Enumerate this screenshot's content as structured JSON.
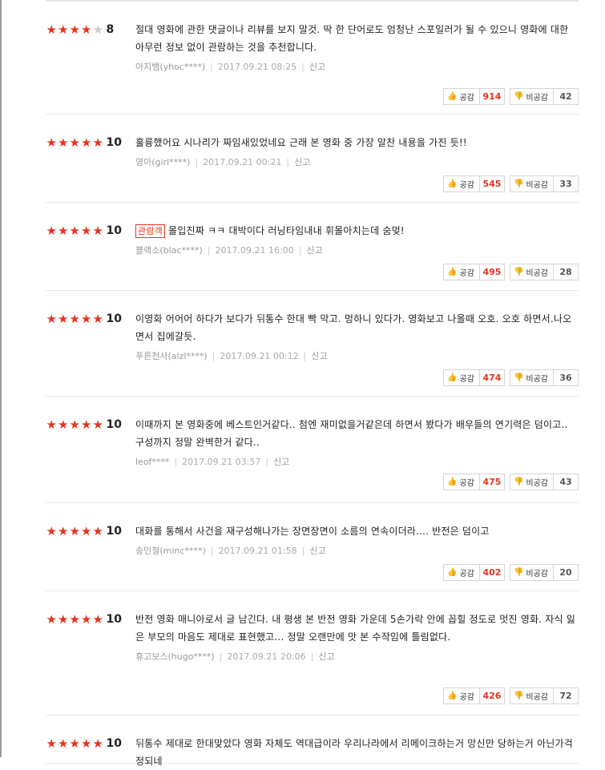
{
  "reviews": [
    {
      "score": "8",
      "stars": 4,
      "badge": "",
      "text": "절대 영화에 관한 댓글이나 리뷰를 보지 말것. 딱 한 단어로도 엄청난 스포일러가 될 수 있으니 영화에 대한 아무런 정보 없이 관람하는 것을 추천합니다.",
      "user": "아지뱀(yhoc****)",
      "date": "2017.09.21 08:25",
      "report": "신고",
      "like_label": "공감",
      "likes": "914",
      "dislike_label": "비공감",
      "dislikes": "42"
    },
    {
      "score": "10",
      "stars": 5,
      "badge": "",
      "text": "훌륭했어요 시나리가 짜임새있었네요 근래 본 영화 중 가장 알찬 내용을 가진 듯!!",
      "user": "영아(girl****)",
      "date": "2017.09.21 00:21",
      "report": "신고",
      "like_label": "공감",
      "likes": "545",
      "dislike_label": "비공감",
      "dislikes": "33"
    },
    {
      "score": "10",
      "stars": 5,
      "badge": "관람객",
      "text": "몰입진짜 ㅋㅋ 대박이다 러닝타임내내 휘몰아치는데 숨멎!",
      "user": "블랙소(blac****)",
      "date": "2017.09.21 16:00",
      "report": "신고",
      "like_label": "공감",
      "likes": "495",
      "dislike_label": "비공감",
      "dislikes": "28"
    },
    {
      "score": "10",
      "stars": 5,
      "badge": "",
      "text": "이영화 어어어 하다가 보다가 뒤통수 한대 빡 막고. 멍하니 있다가. 영화보고 나올때 오호. 오호 하면서.나오면서 집에갈듯.",
      "user": "푸른천사(alzl****)",
      "date": "2017.09.21 00:12",
      "report": "신고",
      "like_label": "공감",
      "likes": "474",
      "dislike_label": "비공감",
      "dislikes": "36"
    },
    {
      "score": "10",
      "stars": 5,
      "badge": "",
      "text": "이때까지 본 영화중에 베스트인거같다.. 첨엔 재미없을거같은데 하면서 봤다가 배우들의 연기력은 덤이고.. 구성까지 정말 완벽한거 같다..",
      "user": "leof****",
      "date": "2017.09.21 03:57",
      "report": "신고",
      "like_label": "공감",
      "likes": "475",
      "dislike_label": "비공감",
      "dislikes": "43"
    },
    {
      "score": "10",
      "stars": 5,
      "badge": "",
      "text": "대화를 통해서 사건을 재구성해나가는 장면장면이 소름의 연속이더라.... 반전은 덤이고",
      "user": "송민철(minc****)",
      "date": "2017.09.21 01:58",
      "report": "신고",
      "like_label": "공감",
      "likes": "402",
      "dislike_label": "비공감",
      "dislikes": "20"
    },
    {
      "score": "10",
      "stars": 5,
      "badge": "",
      "text": "반전 영화 매니아로서 글 남긴다. 내 평생 본 반전 영화 가운데 5손가락 안에 꼽힐 정도로 멋진 영화. 자식 잃은 부모의 마음도 제대로 표현했고... 정말 오랜만에 맛 본 수작임에 틀림없다.",
      "user": "휴고보스(hugo****)",
      "date": "2017.09.21 20:06",
      "report": "신고",
      "like_label": "공감",
      "likes": "426",
      "dislike_label": "비공감",
      "dislikes": "72"
    },
    {
      "score": "10",
      "stars": 5,
      "badge": "",
      "text": "뒤통수 제대로 한대맞았다 영화 자체도 역대급이라 우리나라에서 리메이크하는거 망신만 당하는거 아닌가걱정되네",
      "user": "",
      "date": "",
      "report": "",
      "like_label": "",
      "likes": "",
      "dislike_label": "",
      "dislikes": ""
    }
  ]
}
